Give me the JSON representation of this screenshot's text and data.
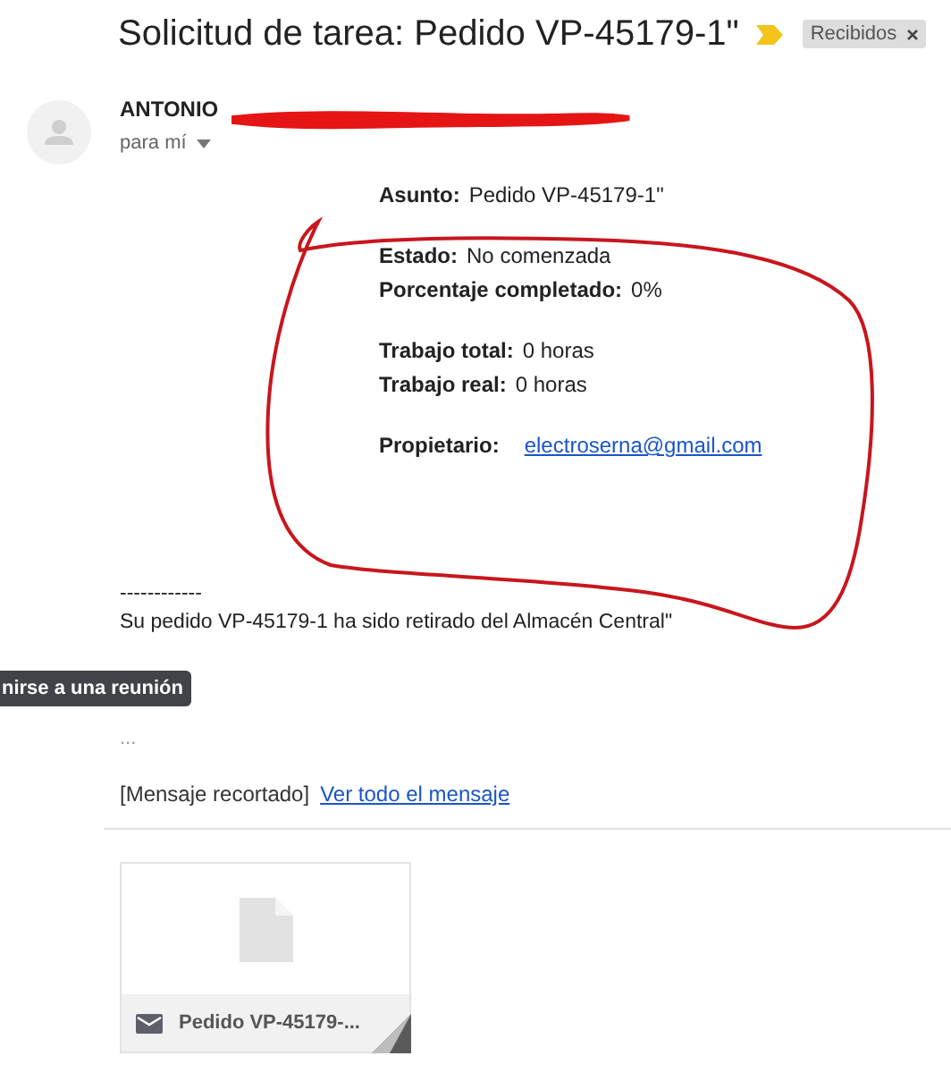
{
  "subject": "Solicitud de tarea: Pedido VP-45179-1\"",
  "label_chip": {
    "text": "Recibidos"
  },
  "sender": {
    "name": "ANTONIO",
    "recipient": "para mí"
  },
  "field_groups": [
    [
      {
        "label": "Asunto:",
        "value": "Pedido VP-45179-1\"",
        "kind": "text"
      }
    ],
    [
      {
        "label": "Estado:",
        "value": "No comenzada",
        "kind": "text"
      },
      {
        "label": "Porcentaje completado:",
        "value": "0%",
        "kind": "text"
      }
    ],
    [
      {
        "label": "Trabajo total:",
        "value": "0 horas",
        "kind": "text"
      },
      {
        "label": "Trabajo real:",
        "value": "0 horas",
        "kind": "text"
      }
    ],
    [
      {
        "label": "Propietario:",
        "value": "electroserna@gmail.com",
        "kind": "link"
      }
    ]
  ],
  "separator": "------------",
  "message": "Su pedido VP-45179-1 ha sido retirado del Almacén Central\"",
  "tooltip": "nirse a una reunión",
  "ellipsis": "...",
  "clipped_note": "[Mensaje recortado]",
  "view_link": "Ver todo el mensaje",
  "attachment": {
    "name": "Pedido VP-45179-..."
  }
}
